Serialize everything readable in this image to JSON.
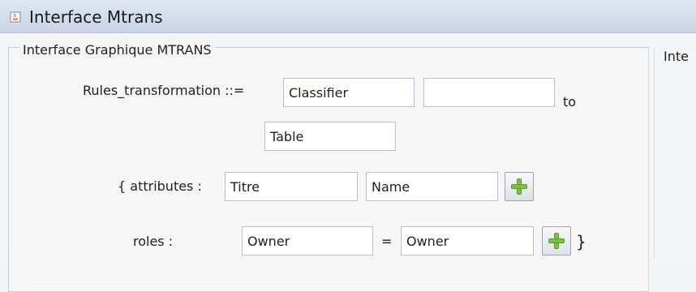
{
  "window": {
    "title": "Interface Mtrans",
    "app_icon": "java-app-icon"
  },
  "panel": {
    "title": "Interface Graphique MTRANS",
    "right_title": "Inte"
  },
  "form": {
    "rules_label": "Rules_transformation ::=",
    "source_value": "Classifier",
    "source2_value": "",
    "to_label": "to",
    "target_value": "Table",
    "attributes_label": "{ attributes :",
    "attr_source_value": "Titre",
    "attr_target_value": "Name",
    "roles_label": "roles :",
    "role_source_value": "Owner",
    "equals_label": "=",
    "role_target_value": "Owner",
    "closing_brace": "}",
    "add_icon": "plus-icon"
  }
}
